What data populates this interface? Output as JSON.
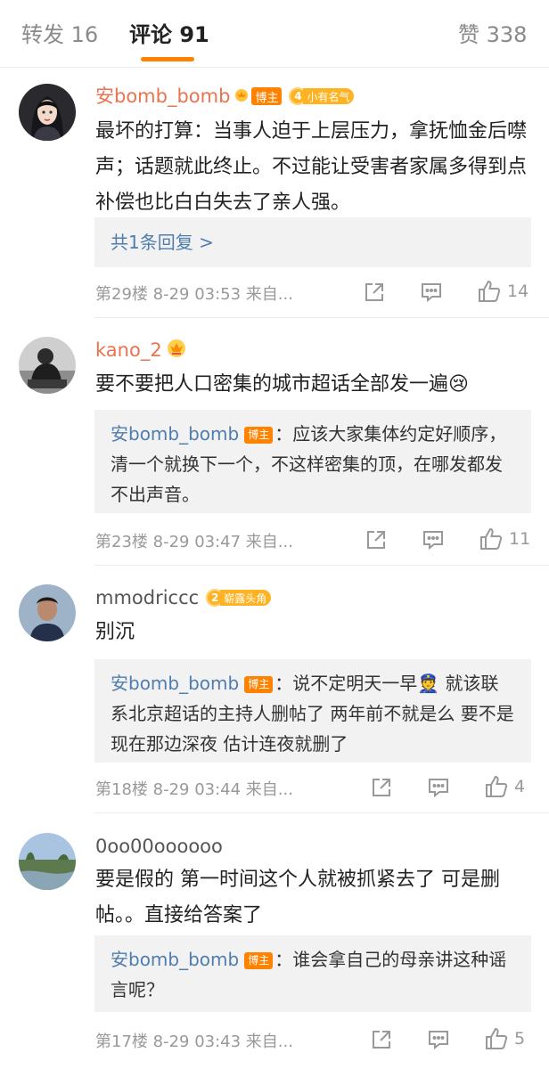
{
  "tabs": {
    "repost": "转发 16",
    "comments": "评论 91",
    "likes": "赞 338"
  },
  "badges": {
    "host": "博主"
  },
  "comments": [
    {
      "user": "安bomb_bomb",
      "level_num": "4",
      "level_title": "小有名气",
      "text": "最坏的打算：当事人迫于上层压力，拿抚恤金后噤声；话题就此终止。不过能让受害者家属多得到点补偿也比白白失去了亲人强。",
      "reply_more": "共1条回复 >",
      "meta": "第29楼  8-29 03:53  来自...",
      "likes": "14"
    },
    {
      "user": "kano_2",
      "text": "要不要把人口密集的城市超话全部发一遍😢",
      "reply_user": "安bomb_bomb",
      "reply_text": "：应该大家集体约定好顺序，清一个就换下一个，不这样密集的顶，在哪发都发不出声音。",
      "meta": "第23楼  8-29 03:47  来自...",
      "likes": "11"
    },
    {
      "user": "mmodriccc",
      "level_num": "2",
      "level_title": "崭露头角",
      "text": "别沉",
      "reply_user": "安bomb_bomb",
      "reply_text": "：说不定明天一早👮 就该联系北京超话的主持人删帖了  两年前不就是么 要不是现在那边深夜 估计连夜就删了",
      "meta": "第18楼  8-29 03:44  来自...",
      "likes": "4"
    },
    {
      "user": "0oo00oooooo",
      "text": "要是假的 第一时间这个人就被抓紧去了  可是删帖。。直接给答案了",
      "reply_user": "安bomb_bomb",
      "reply_text": "：谁会拿自己的母亲讲这种谣言呢？",
      "meta": "第17楼  8-29 03:43  来自...",
      "likes": "5"
    }
  ],
  "colors": {
    "accent": "#ff8200",
    "username_orange": "#eb7350",
    "link_blue": "#507daf",
    "meta_gray": "#999999"
  },
  "icons": [
    "share-icon",
    "comment-icon",
    "like-icon",
    "crown-icon"
  ]
}
